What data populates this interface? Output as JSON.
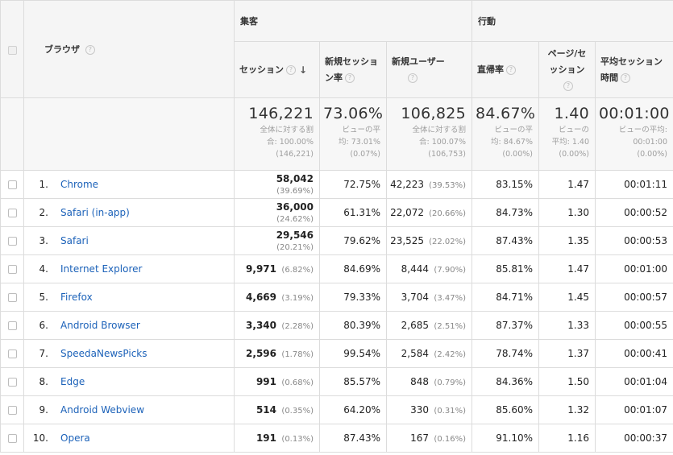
{
  "header": {
    "dimension_label": "ブラウザ",
    "groups": {
      "acquisition": "集客",
      "behavior": "行動"
    },
    "help_glyph": "?",
    "sort_glyph": "↓",
    "columns": [
      {
        "label": "セッション",
        "sorted": true
      },
      {
        "label": "新規セッション率"
      },
      {
        "label": "新規ユーザー"
      },
      {
        "label": "直帰率"
      },
      {
        "label": "ページ/セッション"
      },
      {
        "label": "平均セッション時間"
      }
    ]
  },
  "totals": [
    {
      "value": "146,221",
      "sub1": "全体に対する割",
      "sub2": "合: 100.00%",
      "sub3": "(146,221)"
    },
    {
      "value": "73.06%",
      "sub1": "ビューの平",
      "sub2": "均: 73.01%",
      "sub3": "(0.07%)"
    },
    {
      "value": "106,825",
      "sub1": "全体に対する割",
      "sub2": "合: 100.07%",
      "sub3": "(106,753)"
    },
    {
      "value": "84.67%",
      "sub1": "ビューの平",
      "sub2": "均: 84.67%",
      "sub3": "(0.00%)"
    },
    {
      "value": "1.40",
      "sub1": "ビューの",
      "sub2": "平均: 1.40",
      "sub3": "(0.00%)"
    },
    {
      "value": "00:01:00",
      "sub1": "ビューの平均:",
      "sub2": "00:01:00",
      "sub3": "(0.00%)"
    }
  ],
  "rows": [
    {
      "index": "1.",
      "browser": "Chrome",
      "sessions": "58,042",
      "sessions_pct": "(39.69%)",
      "new_session_rate": "72.75%",
      "new_users": "42,223",
      "new_users_pct": "(39.53%)",
      "bounce_rate": "83.15%",
      "pages_per_session": "1.47",
      "avg_duration": "00:01:11"
    },
    {
      "index": "2.",
      "browser": "Safari (in-app)",
      "sessions": "36,000",
      "sessions_pct": "(24.62%)",
      "new_session_rate": "61.31%",
      "new_users": "22,072",
      "new_users_pct": "(20.66%)",
      "bounce_rate": "84.73%",
      "pages_per_session": "1.30",
      "avg_duration": "00:00:52"
    },
    {
      "index": "3.",
      "browser": "Safari",
      "sessions": "29,546",
      "sessions_pct": "(20.21%)",
      "new_session_rate": "79.62%",
      "new_users": "23,525",
      "new_users_pct": "(22.02%)",
      "bounce_rate": "87.43%",
      "pages_per_session": "1.35",
      "avg_duration": "00:00:53"
    },
    {
      "index": "4.",
      "browser": "Internet Explorer",
      "sessions": "9,971",
      "sessions_pct": "(6.82%)",
      "new_session_rate": "84.69%",
      "new_users": "8,444",
      "new_users_pct": "(7.90%)",
      "bounce_rate": "85.81%",
      "pages_per_session": "1.47",
      "avg_duration": "00:01:00"
    },
    {
      "index": "5.",
      "browser": "Firefox",
      "sessions": "4,669",
      "sessions_pct": "(3.19%)",
      "new_session_rate": "79.33%",
      "new_users": "3,704",
      "new_users_pct": "(3.47%)",
      "bounce_rate": "84.71%",
      "pages_per_session": "1.45",
      "avg_duration": "00:00:57"
    },
    {
      "index": "6.",
      "browser": "Android Browser",
      "sessions": "3,340",
      "sessions_pct": "(2.28%)",
      "new_session_rate": "80.39%",
      "new_users": "2,685",
      "new_users_pct": "(2.51%)",
      "bounce_rate": "87.37%",
      "pages_per_session": "1.33",
      "avg_duration": "00:00:55"
    },
    {
      "index": "7.",
      "browser": "SpeedaNewsPicks",
      "sessions": "2,596",
      "sessions_pct": "(1.78%)",
      "new_session_rate": "99.54%",
      "new_users": "2,584",
      "new_users_pct": "(2.42%)",
      "bounce_rate": "78.74%",
      "pages_per_session": "1.37",
      "avg_duration": "00:00:41"
    },
    {
      "index": "8.",
      "browser": "Edge",
      "sessions": "991",
      "sessions_pct": "(0.68%)",
      "new_session_rate": "85.57%",
      "new_users": "848",
      "new_users_pct": "(0.79%)",
      "bounce_rate": "84.36%",
      "pages_per_session": "1.50",
      "avg_duration": "00:01:04"
    },
    {
      "index": "9.",
      "browser": "Android Webview",
      "sessions": "514",
      "sessions_pct": "(0.35%)",
      "new_session_rate": "64.20%",
      "new_users": "330",
      "new_users_pct": "(0.31%)",
      "bounce_rate": "85.60%",
      "pages_per_session": "1.32",
      "avg_duration": "00:01:07"
    },
    {
      "index": "10.",
      "browser": "Opera",
      "sessions": "191",
      "sessions_pct": "(0.13%)",
      "new_session_rate": "87.43%",
      "new_users": "167",
      "new_users_pct": "(0.16%)",
      "bounce_rate": "91.10%",
      "pages_per_session": "1.16",
      "avg_duration": "00:00:37"
    }
  ],
  "colors": {
    "link": "#1c62b9",
    "header_bg": "#f5f5f5",
    "border": "#dcdcdc"
  }
}
